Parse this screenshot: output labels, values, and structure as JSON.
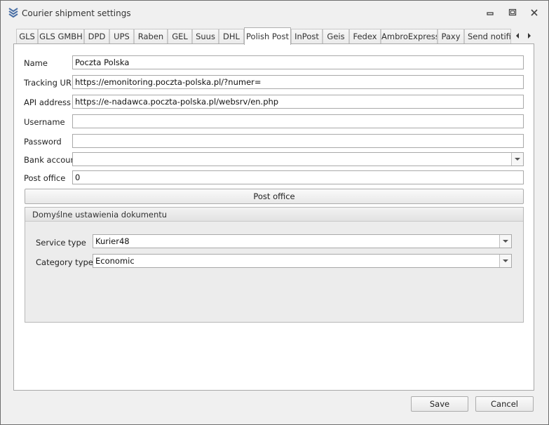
{
  "window": {
    "title": "Courier shipment settings"
  },
  "tabs": [
    "GLS",
    "GLS GMBH",
    "DPD",
    "UPS",
    "Raben",
    "GEL",
    "Suus",
    "DHL",
    "Polish Post",
    "InPost",
    "Geis",
    "Fedex",
    "AmbroExpress",
    "Paxy",
    "Send notifi"
  ],
  "active_tab": "Polish Post",
  "form": {
    "name_label": "Name",
    "name_value": "Poczta Polska",
    "tracking_label": "Tracking URL",
    "tracking_value": "https://emonitoring.poczta-polska.pl/?numer=",
    "api_label": "API address",
    "api_value": "https://e-nadawca.poczta-polska.pl/websrv/en.php",
    "username_label": "Username",
    "username_value": "",
    "password_label": "Password",
    "password_value": "",
    "bank_label": "Bank account",
    "bank_value": "",
    "postoffice_label": "Post office",
    "postoffice_value": "0",
    "postoffice_button": "Post office"
  },
  "group": {
    "title": "Domyślne ustawienia dokumentu",
    "service_label": "Service type",
    "service_value": "Kurier48",
    "category_label": "Category type",
    "category_value": "Economic"
  },
  "footer": {
    "save": "Save",
    "cancel": "Cancel"
  },
  "colors": {
    "window_bg": "#f0f0f0",
    "panel_bg": "#ffffff",
    "border": "#a9a9a9",
    "icon_blue": "#4a6fa5"
  }
}
